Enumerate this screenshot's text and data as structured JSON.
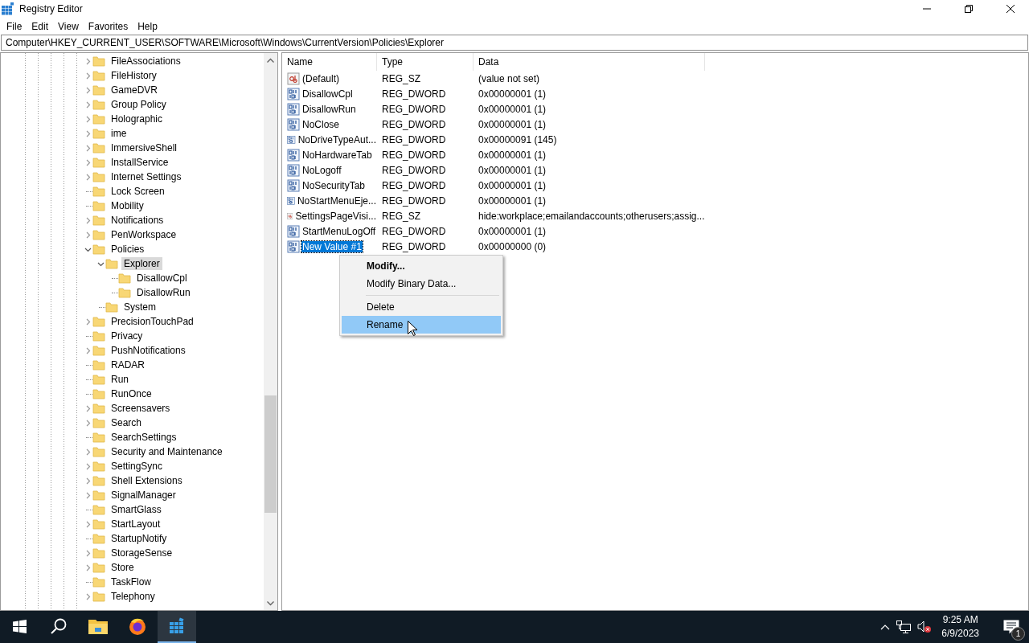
{
  "window": {
    "title": "Registry Editor"
  },
  "menu": [
    "File",
    "Edit",
    "View",
    "Favorites",
    "Help"
  ],
  "address": "Computer\\HKEY_CURRENT_USER\\SOFTWARE\\Microsoft\\Windows\\CurrentVersion\\Policies\\Explorer",
  "tree": [
    {
      "label": "FileAssociations",
      "expanded": false,
      "selected": false
    },
    {
      "label": "FileHistory",
      "expanded": false,
      "selected": false
    },
    {
      "label": "GameDVR",
      "expanded": false,
      "selected": false
    },
    {
      "label": "Group Policy",
      "expanded": false,
      "selected": false
    },
    {
      "label": "Holographic",
      "expanded": false,
      "selected": false
    },
    {
      "label": "ime",
      "expanded": false,
      "selected": false
    },
    {
      "label": "ImmersiveShell",
      "expanded": false,
      "selected": false
    },
    {
      "label": "InstallService",
      "expanded": false,
      "selected": false
    },
    {
      "label": "Internet Settings",
      "expanded": false,
      "selected": false
    },
    {
      "label": "Lock Screen",
      "selected": false
    },
    {
      "label": "Mobility",
      "selected": false
    },
    {
      "label": "Notifications",
      "expanded": false,
      "selected": false
    },
    {
      "label": "PenWorkspace",
      "expanded": false,
      "selected": false
    },
    {
      "label": "Policies",
      "expanded": true,
      "selected": false,
      "children": [
        {
          "label": "Explorer",
          "expanded": true,
          "selected": true,
          "children": [
            {
              "label": "DisallowCpl",
              "selected": false
            },
            {
              "label": "DisallowRun",
              "selected": false
            }
          ]
        },
        {
          "label": "System",
          "selected": false
        }
      ]
    },
    {
      "label": "PrecisionTouchPad",
      "expanded": false,
      "selected": false
    },
    {
      "label": "Privacy",
      "selected": false
    },
    {
      "label": "PushNotifications",
      "expanded": false,
      "selected": false
    },
    {
      "label": "RADAR",
      "selected": false
    },
    {
      "label": "Run",
      "selected": false
    },
    {
      "label": "RunOnce",
      "selected": false
    },
    {
      "label": "Screensavers",
      "expanded": false,
      "selected": false
    },
    {
      "label": "Search",
      "expanded": false,
      "selected": false
    },
    {
      "label": "SearchSettings",
      "selected": false
    },
    {
      "label": "Security and Maintenance",
      "expanded": false,
      "selected": false
    },
    {
      "label": "SettingSync",
      "expanded": false,
      "selected": false
    },
    {
      "label": "Shell Extensions",
      "expanded": false,
      "selected": false
    },
    {
      "label": "SignalManager",
      "expanded": false,
      "selected": false
    },
    {
      "label": "SmartGlass",
      "selected": false
    },
    {
      "label": "StartLayout",
      "expanded": false,
      "selected": false
    },
    {
      "label": "StartupNotify",
      "selected": false
    },
    {
      "label": "StorageSense",
      "expanded": false,
      "selected": false
    },
    {
      "label": "Store",
      "expanded": false,
      "selected": false
    },
    {
      "label": "TaskFlow",
      "selected": false
    },
    {
      "label": "Telephony",
      "expanded": false,
      "selected": false
    }
  ],
  "columns": [
    "Name",
    "Type",
    "Data"
  ],
  "values": [
    {
      "kind": "string",
      "name": "(Default)",
      "type": "REG_SZ",
      "data": "(value not set)",
      "selected": false
    },
    {
      "kind": "binary",
      "name": "DisallowCpl",
      "type": "REG_DWORD",
      "data": "0x00000001 (1)",
      "selected": false
    },
    {
      "kind": "binary",
      "name": "DisallowRun",
      "type": "REG_DWORD",
      "data": "0x00000001 (1)",
      "selected": false
    },
    {
      "kind": "binary",
      "name": "NoClose",
      "type": "REG_DWORD",
      "data": "0x00000001 (1)",
      "selected": false
    },
    {
      "kind": "binary",
      "name": "NoDriveTypeAut...",
      "type": "REG_DWORD",
      "data": "0x00000091 (145)",
      "selected": false
    },
    {
      "kind": "binary",
      "name": "NoHardwareTab",
      "type": "REG_DWORD",
      "data": "0x00000001 (1)",
      "selected": false
    },
    {
      "kind": "binary",
      "name": "NoLogoff",
      "type": "REG_DWORD",
      "data": "0x00000001 (1)",
      "selected": false
    },
    {
      "kind": "binary",
      "name": "NoSecurityTab",
      "type": "REG_DWORD",
      "data": "0x00000001 (1)",
      "selected": false
    },
    {
      "kind": "binary",
      "name": "NoStartMenuEje...",
      "type": "REG_DWORD",
      "data": "0x00000001 (1)",
      "selected": false
    },
    {
      "kind": "string",
      "name": "SettingsPageVisi...",
      "type": "REG_SZ",
      "data": "hide:workplace;emailandaccounts;otherusers;assig...",
      "selected": false
    },
    {
      "kind": "binary",
      "name": "StartMenuLogOff",
      "type": "REG_DWORD",
      "data": "0x00000001 (1)",
      "selected": false
    },
    {
      "kind": "binary",
      "name": "New Value #1",
      "type": "REG_DWORD",
      "data": "0x00000000 (0)",
      "selected": true
    }
  ],
  "context_menu": [
    {
      "kind": "item",
      "label": "Modify...",
      "default": true,
      "selected": false
    },
    {
      "kind": "item",
      "label": "Modify Binary Data...",
      "default": false,
      "selected": false
    },
    {
      "kind": "separator"
    },
    {
      "kind": "item",
      "label": "Delete",
      "default": false,
      "selected": false
    },
    {
      "kind": "item",
      "label": "Rename",
      "default": false,
      "selected": true
    }
  ],
  "taskbar": {
    "apps": [
      {
        "kind": "start",
        "selected": false
      },
      {
        "kind": "search",
        "selected": false
      },
      {
        "kind": "files",
        "selected": false
      },
      {
        "kind": "browser",
        "selected": false
      },
      {
        "kind": "registry",
        "selected": true
      }
    ],
    "time": "9:25 AM",
    "date": "6/9/2023",
    "notification_count": "1"
  }
}
